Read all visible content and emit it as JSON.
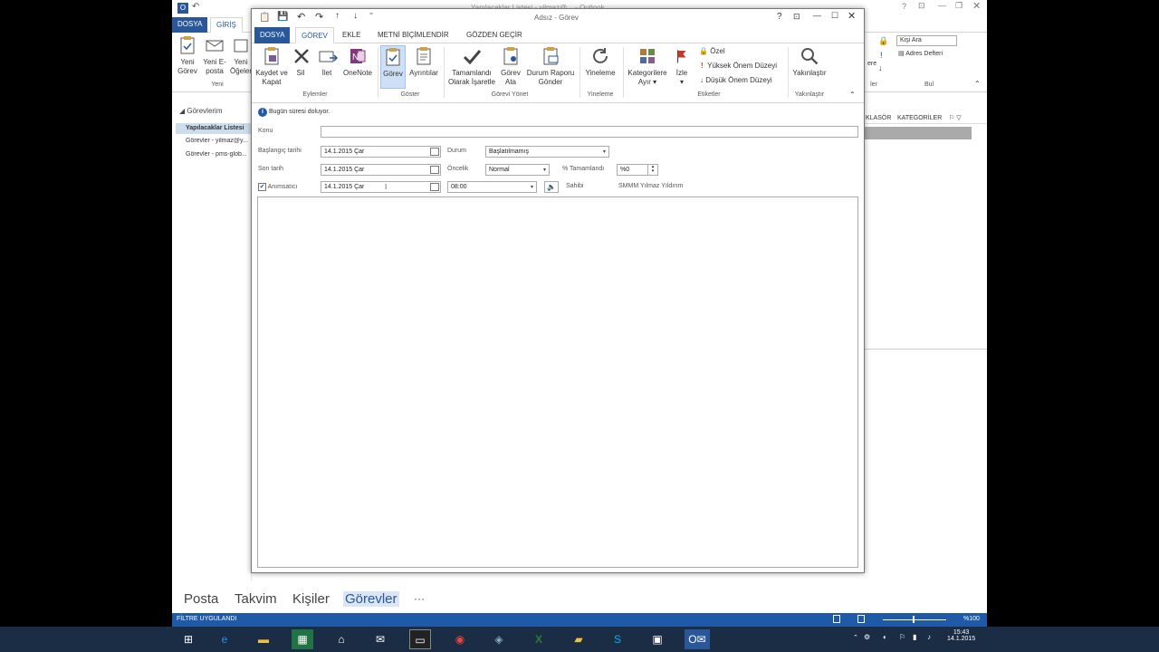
{
  "outlook": {
    "title": "Yapılacaklar Listesi - yilmaz@... - Outlook",
    "tabs": [
      "DOSYA",
      "GİRİŞ"
    ],
    "ribbon": {
      "new_task": "Yeni Görev",
      "new_email": "Yeni E-posta",
      "new_items": "Yeni Öğeler",
      "group_new": "Yeni",
      "search_people": "Kişi Ara",
      "address_book": "Adres Defteri",
      "group_find": "Bul",
      "group_tags": "ler"
    },
    "nav": {
      "header": "Görevlerim",
      "items": [
        "Yapılacaklar Listesi",
        "Görevler - yilmaz@y...",
        "Görevler - pms-glob..."
      ]
    },
    "list_headers": [
      "KLASÖR",
      "KATEGORİLER"
    ],
    "bottom_nav": [
      "Posta",
      "Takvim",
      "Kişiler",
      "Görevler",
      "···"
    ],
    "status": {
      "left": "FİLTRE UYGULANDI",
      "zoom": "%100"
    }
  },
  "dialog": {
    "title": "Adsız - Görev",
    "tabs": [
      "DOSYA",
      "GÖREV",
      "EKLE",
      "METNİ BİÇİMLENDİR",
      "GÖZDEN GEÇİR"
    ],
    "ribbon": {
      "save_close": "Kaydet ve Kapat",
      "delete": "Sil",
      "forward": "İlet",
      "onenote": "OneNote",
      "group_actions": "Eylemler",
      "task": "Görev",
      "details": "Ayrıntılar",
      "group_show": "Göster",
      "mark_complete": "Tamamlandı Olarak İşaretle",
      "assign_task": "Görev Ata",
      "send_status": "Durum Raporu Gönder",
      "group_manage": "Görevi Yönet",
      "recurrence": "Yineleme",
      "group_recurrence": "Yineleme",
      "categorize": "Kategorilere Ayır",
      "follow_up": "İzle",
      "private": "Özel",
      "high_importance": "Yüksek Önem Düzeyi",
      "low_importance": "Düşük Önem Düzeyi",
      "group_tags": "Etiketler",
      "zoom": "Yakınlaştır",
      "group_zoom": "Yakınlaştır"
    },
    "form": {
      "info": "Bugün süresi doluyor.",
      "subject_label": "Konu",
      "subject_value": "",
      "start_label": "Başlangıç tarihi",
      "start_value": "14.1.2015 Çar",
      "due_label": "Son tarih",
      "due_value": "14.1.2015 Çar",
      "reminder_label": "Anımsatıcı",
      "reminder_date": "14.1.2015 Çar",
      "reminder_time": "08:00",
      "status_label": "Durum",
      "status_value": "Başlatılmamış",
      "priority_label": "Öncelik",
      "priority_value": "Normal",
      "percent_label": "% Tamamlandı",
      "percent_value": "%0",
      "owner_label": "Sahibi",
      "owner_value": "SMMM Yılmaz Yıldırım"
    }
  },
  "taskbar": {
    "clock_time": "15:43",
    "clock_date": "14.1.2015"
  }
}
